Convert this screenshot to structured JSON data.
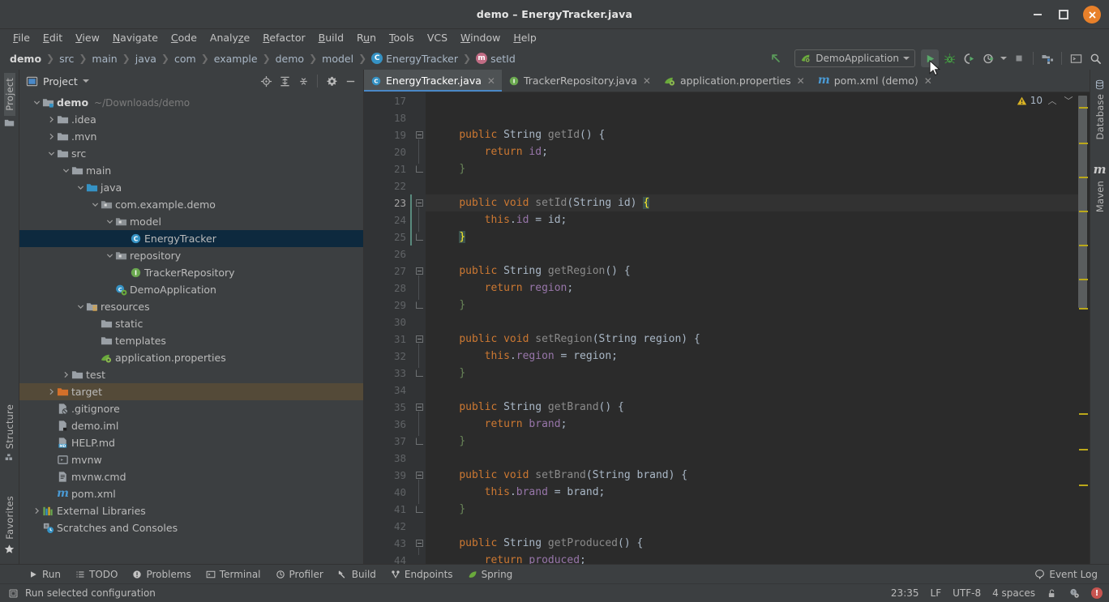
{
  "window": {
    "title": "demo – EnergyTracker.java",
    "controls": {
      "minimize": "minimize-icon",
      "maximize": "maximize-icon",
      "close": "✕"
    }
  },
  "menubar": {
    "items": [
      {
        "label": "File",
        "mnemonic": "F"
      },
      {
        "label": "Edit",
        "mnemonic": "E"
      },
      {
        "label": "View",
        "mnemonic": "V"
      },
      {
        "label": "Navigate",
        "mnemonic": "N"
      },
      {
        "label": "Code",
        "mnemonic": "C"
      },
      {
        "label": "Analyze",
        "mnemonic": "z"
      },
      {
        "label": "Refactor",
        "mnemonic": "R"
      },
      {
        "label": "Build",
        "mnemonic": "B"
      },
      {
        "label": "Run",
        "mnemonic": "u"
      },
      {
        "label": "Tools",
        "mnemonic": "T"
      },
      {
        "label": "VCS",
        "mnemonic": ""
      },
      {
        "label": "Window",
        "mnemonic": "W"
      },
      {
        "label": "Help",
        "mnemonic": "H"
      }
    ]
  },
  "breadcrumbs": [
    {
      "label": "demo",
      "icon": "",
      "root": true
    },
    {
      "label": "src",
      "icon": ""
    },
    {
      "label": "main",
      "icon": ""
    },
    {
      "label": "java",
      "icon": ""
    },
    {
      "label": "com",
      "icon": ""
    },
    {
      "label": "example",
      "icon": ""
    },
    {
      "label": "demo",
      "icon": ""
    },
    {
      "label": "model",
      "icon": ""
    },
    {
      "label": "EnergyTracker",
      "icon": "class-icon",
      "icon_letter": "C"
    },
    {
      "label": "setId",
      "icon": "method-icon",
      "icon_letter": "m"
    }
  ],
  "toolbar": {
    "back_icon": "arrow-up-left-icon",
    "run_config": {
      "label": "DemoApplication",
      "icon": "spring-leaf-icon"
    },
    "buttons": [
      {
        "name": "run-button",
        "icon": "play-icon"
      },
      {
        "name": "debug-button",
        "icon": "bug-icon"
      },
      {
        "name": "run-with-coverage-button",
        "icon": "coverage-icon"
      },
      {
        "name": "profile-button",
        "icon": "profiler-icon"
      },
      {
        "name": "stop-button",
        "icon": "stop-icon"
      },
      {
        "name": "project-structure-button",
        "icon": "project-structure-icon"
      },
      {
        "name": "terminal-button",
        "icon": "terminal-icon"
      },
      {
        "name": "search-everywhere-button",
        "icon": "search-icon"
      }
    ]
  },
  "left_strip": {
    "project_tab": "Project",
    "structure_tab": "Structure",
    "favorites_tab": "Favorites"
  },
  "right_strip": {
    "database_tab": "Database",
    "maven_tab": "Maven"
  },
  "project_panel": {
    "title": "Project",
    "icons": [
      "locate-icon",
      "expand-all-icon",
      "collapse-all-icon",
      "settings-gear-icon",
      "hide-icon"
    ],
    "tree": [
      {
        "label": "demo",
        "path": "~/Downloads/demo",
        "indent": 0,
        "arrow": "down",
        "icon": "module-folder-icon",
        "bold": true
      },
      {
        "label": ".idea",
        "indent": 1,
        "arrow": "right",
        "icon": "folder-icon"
      },
      {
        "label": ".mvn",
        "indent": 1,
        "arrow": "right",
        "icon": "folder-icon"
      },
      {
        "label": "src",
        "indent": 1,
        "arrow": "down",
        "icon": "folder-icon"
      },
      {
        "label": "main",
        "indent": 2,
        "arrow": "down",
        "icon": "folder-icon"
      },
      {
        "label": "java",
        "indent": 3,
        "arrow": "down",
        "icon": "source-folder-icon"
      },
      {
        "label": "com.example.demo",
        "indent": 4,
        "arrow": "down",
        "icon": "package-icon"
      },
      {
        "label": "model",
        "indent": 5,
        "arrow": "down",
        "icon": "package-icon"
      },
      {
        "label": "EnergyTracker",
        "indent": 6,
        "arrow": "none",
        "icon": "class-icon",
        "selected": true
      },
      {
        "label": "repository",
        "indent": 5,
        "arrow": "down",
        "icon": "package-icon"
      },
      {
        "label": "TrackerRepository",
        "indent": 6,
        "arrow": "none",
        "icon": "interface-icon"
      },
      {
        "label": "DemoApplication",
        "indent": 5,
        "arrow": "none",
        "icon": "spring-class-icon"
      },
      {
        "label": "resources",
        "indent": 3,
        "arrow": "down",
        "icon": "resources-folder-icon"
      },
      {
        "label": "static",
        "indent": 4,
        "arrow": "none",
        "icon": "folder-icon"
      },
      {
        "label": "templates",
        "indent": 4,
        "arrow": "none",
        "icon": "folder-icon"
      },
      {
        "label": "application.properties",
        "indent": 4,
        "arrow": "none",
        "icon": "spring-properties-icon"
      },
      {
        "label": "test",
        "indent": 2,
        "arrow": "right",
        "icon": "folder-icon"
      },
      {
        "label": "target",
        "indent": 1,
        "arrow": "right",
        "icon": "excluded-folder-icon",
        "highlighted": true
      },
      {
        "label": ".gitignore",
        "indent": 1,
        "arrow": "none",
        "icon": "gitignore-icon"
      },
      {
        "label": "demo.iml",
        "indent": 1,
        "arrow": "none",
        "icon": "iml-icon"
      },
      {
        "label": "HELP.md",
        "indent": 1,
        "arrow": "none",
        "icon": "markdown-icon"
      },
      {
        "label": "mvnw",
        "indent": 1,
        "arrow": "none",
        "icon": "script-icon"
      },
      {
        "label": "mvnw.cmd",
        "indent": 1,
        "arrow": "none",
        "icon": "cmd-icon"
      },
      {
        "label": "pom.xml",
        "indent": 1,
        "arrow": "none",
        "icon": "maven-icon"
      },
      {
        "label": "External Libraries",
        "indent": 0,
        "arrow": "right",
        "icon": "libraries-icon"
      },
      {
        "label": "Scratches and Consoles",
        "indent": 0,
        "arrow": "none",
        "icon": "scratches-icon"
      }
    ]
  },
  "editor": {
    "tabs": [
      {
        "label": "EnergyTracker.java",
        "icon": "class-icon",
        "icon_letter": "C",
        "active": true
      },
      {
        "label": "TrackerRepository.java",
        "icon": "interface-icon",
        "icon_letter": "I",
        "active": false
      },
      {
        "label": "application.properties",
        "icon": "spring-properties-icon",
        "active": false
      },
      {
        "label": "pom.xml (demo)",
        "icon": "maven-icon",
        "active": false
      }
    ],
    "warning_count": "10",
    "warning_icon": "warning-triangle-icon",
    "first_line": 17,
    "current_line": 23,
    "lines": [
      {
        "n": 17,
        "tokens": []
      },
      {
        "n": 18,
        "tokens": []
      },
      {
        "n": 19,
        "fold": "start",
        "tokens": [
          {
            "t": "    ",
            "c": "punct"
          },
          {
            "t": "public",
            "c": "kw"
          },
          {
            "t": " ",
            "c": "punct"
          },
          {
            "t": "String",
            "c": "ty"
          },
          {
            "t": " ",
            "c": "punct"
          },
          {
            "t": "getId",
            "c": "mname"
          },
          {
            "t": "() {",
            "c": "punct"
          }
        ]
      },
      {
        "n": 20,
        "tokens": [
          {
            "t": "        ",
            "c": "punct"
          },
          {
            "t": "return",
            "c": "kw"
          },
          {
            "t": " ",
            "c": "punct"
          },
          {
            "t": "id",
            "c": "fld"
          },
          {
            "t": ";",
            "c": "punct"
          }
        ]
      },
      {
        "n": 21,
        "fold": "end",
        "tokens": [
          {
            "t": "    ",
            "c": "punct"
          },
          {
            "t": "}",
            "c": "brace"
          }
        ]
      },
      {
        "n": 22,
        "tokens": []
      },
      {
        "n": 23,
        "fold": "start",
        "current": true,
        "tokens": [
          {
            "t": "    ",
            "c": "punct"
          },
          {
            "t": "public",
            "c": "kw"
          },
          {
            "t": " ",
            "c": "punct"
          },
          {
            "t": "void",
            "c": "kw"
          },
          {
            "t": " ",
            "c": "punct"
          },
          {
            "t": "setId",
            "c": "mname"
          },
          {
            "t": "(",
            "c": "punct"
          },
          {
            "t": "String",
            "c": "ty"
          },
          {
            "t": " id) ",
            "c": "punct"
          },
          {
            "t": "{",
            "c": "matchbr"
          }
        ]
      },
      {
        "n": 24,
        "tokens": [
          {
            "t": "        ",
            "c": "punct"
          },
          {
            "t": "this",
            "c": "kw"
          },
          {
            "t": ".",
            "c": "punct"
          },
          {
            "t": "id",
            "c": "fld"
          },
          {
            "t": " = id;",
            "c": "punct"
          }
        ]
      },
      {
        "n": 25,
        "fold": "end",
        "tokens": [
          {
            "t": "    ",
            "c": "punct"
          },
          {
            "t": "}",
            "c": "matchbr"
          }
        ]
      },
      {
        "n": 26,
        "tokens": []
      },
      {
        "n": 27,
        "fold": "start",
        "tokens": [
          {
            "t": "    ",
            "c": "punct"
          },
          {
            "t": "public",
            "c": "kw"
          },
          {
            "t": " ",
            "c": "punct"
          },
          {
            "t": "String",
            "c": "ty"
          },
          {
            "t": " ",
            "c": "punct"
          },
          {
            "t": "getRegion",
            "c": "mname"
          },
          {
            "t": "() {",
            "c": "punct"
          }
        ]
      },
      {
        "n": 28,
        "tokens": [
          {
            "t": "        ",
            "c": "punct"
          },
          {
            "t": "return",
            "c": "kw"
          },
          {
            "t": " ",
            "c": "punct"
          },
          {
            "t": "region",
            "c": "fld"
          },
          {
            "t": ";",
            "c": "punct"
          }
        ]
      },
      {
        "n": 29,
        "fold": "end",
        "tokens": [
          {
            "t": "    ",
            "c": "punct"
          },
          {
            "t": "}",
            "c": "brace"
          }
        ]
      },
      {
        "n": 30,
        "tokens": []
      },
      {
        "n": 31,
        "fold": "start",
        "tokens": [
          {
            "t": "    ",
            "c": "punct"
          },
          {
            "t": "public",
            "c": "kw"
          },
          {
            "t": " ",
            "c": "punct"
          },
          {
            "t": "void",
            "c": "kw"
          },
          {
            "t": " ",
            "c": "punct"
          },
          {
            "t": "setRegion",
            "c": "mname"
          },
          {
            "t": "(",
            "c": "punct"
          },
          {
            "t": "String",
            "c": "ty"
          },
          {
            "t": " region) {",
            "c": "punct"
          }
        ]
      },
      {
        "n": 32,
        "tokens": [
          {
            "t": "        ",
            "c": "punct"
          },
          {
            "t": "this",
            "c": "kw"
          },
          {
            "t": ".",
            "c": "punct"
          },
          {
            "t": "region",
            "c": "fld"
          },
          {
            "t": " = region;",
            "c": "punct"
          }
        ]
      },
      {
        "n": 33,
        "fold": "end",
        "tokens": [
          {
            "t": "    ",
            "c": "punct"
          },
          {
            "t": "}",
            "c": "brace"
          }
        ]
      },
      {
        "n": 34,
        "tokens": []
      },
      {
        "n": 35,
        "fold": "start",
        "tokens": [
          {
            "t": "    ",
            "c": "punct"
          },
          {
            "t": "public",
            "c": "kw"
          },
          {
            "t": " ",
            "c": "punct"
          },
          {
            "t": "String",
            "c": "ty"
          },
          {
            "t": " ",
            "c": "punct"
          },
          {
            "t": "getBrand",
            "c": "mname"
          },
          {
            "t": "() {",
            "c": "punct"
          }
        ]
      },
      {
        "n": 36,
        "tokens": [
          {
            "t": "        ",
            "c": "punct"
          },
          {
            "t": "return",
            "c": "kw"
          },
          {
            "t": " ",
            "c": "punct"
          },
          {
            "t": "brand",
            "c": "fld"
          },
          {
            "t": ";",
            "c": "punct"
          }
        ]
      },
      {
        "n": 37,
        "fold": "end",
        "tokens": [
          {
            "t": "    ",
            "c": "punct"
          },
          {
            "t": "}",
            "c": "brace"
          }
        ]
      },
      {
        "n": 38,
        "tokens": []
      },
      {
        "n": 39,
        "fold": "start",
        "tokens": [
          {
            "t": "    ",
            "c": "punct"
          },
          {
            "t": "public",
            "c": "kw"
          },
          {
            "t": " ",
            "c": "punct"
          },
          {
            "t": "void",
            "c": "kw"
          },
          {
            "t": " ",
            "c": "punct"
          },
          {
            "t": "setBrand",
            "c": "mname"
          },
          {
            "t": "(",
            "c": "punct"
          },
          {
            "t": "String",
            "c": "ty"
          },
          {
            "t": " brand) {",
            "c": "punct"
          }
        ]
      },
      {
        "n": 40,
        "tokens": [
          {
            "t": "        ",
            "c": "punct"
          },
          {
            "t": "this",
            "c": "kw"
          },
          {
            "t": ".",
            "c": "punct"
          },
          {
            "t": "brand",
            "c": "fld"
          },
          {
            "t": " = brand;",
            "c": "punct"
          }
        ]
      },
      {
        "n": 41,
        "fold": "end",
        "tokens": [
          {
            "t": "    ",
            "c": "punct"
          },
          {
            "t": "}",
            "c": "brace"
          }
        ]
      },
      {
        "n": 42,
        "tokens": []
      },
      {
        "n": 43,
        "fold": "start",
        "tokens": [
          {
            "t": "    ",
            "c": "punct"
          },
          {
            "t": "public",
            "c": "kw"
          },
          {
            "t": " ",
            "c": "punct"
          },
          {
            "t": "String",
            "c": "ty"
          },
          {
            "t": " ",
            "c": "punct"
          },
          {
            "t": "getProduced",
            "c": "mname"
          },
          {
            "t": "() {",
            "c": "punct"
          }
        ]
      },
      {
        "n": 44,
        "tokens": [
          {
            "t": "        ",
            "c": "punct"
          },
          {
            "t": "return",
            "c": "kw"
          },
          {
            "t": " ",
            "c": "punct"
          },
          {
            "t": "produced",
            "c": "fld"
          },
          {
            "t": ";",
            "c": "punct"
          }
        ]
      }
    ]
  },
  "bottom_bar": {
    "items": [
      {
        "label": "Run",
        "icon": "play-icon"
      },
      {
        "label": "TODO",
        "icon": "todo-icon"
      },
      {
        "label": "Problems",
        "icon": "problems-icon"
      },
      {
        "label": "Terminal",
        "icon": "terminal-icon"
      },
      {
        "label": "Profiler",
        "icon": "profiler-icon"
      },
      {
        "label": "Build",
        "icon": "hammer-icon"
      },
      {
        "label": "Endpoints",
        "icon": "endpoints-icon"
      },
      {
        "label": "Spring",
        "icon": "spring-leaf-icon"
      }
    ],
    "event_log": {
      "label": "Event Log",
      "icon": "balloon-icon"
    }
  },
  "status_bar": {
    "message": "Run selected configuration",
    "message_icon": "tip-icon",
    "time": "23:35",
    "line_separator": "LF",
    "encoding": "UTF-8",
    "indent": "4 spaces",
    "lock_icon": "unlocked-icon",
    "inspection_icon": "inspections-icon",
    "error_icon": "error-badge-icon"
  },
  "colors": {
    "accent": "#4a88c7",
    "close_button": "#e8802a",
    "selection": "#0d293e",
    "keyword": "#cc7832",
    "field": "#9876aa",
    "warning": "#bba81a"
  }
}
